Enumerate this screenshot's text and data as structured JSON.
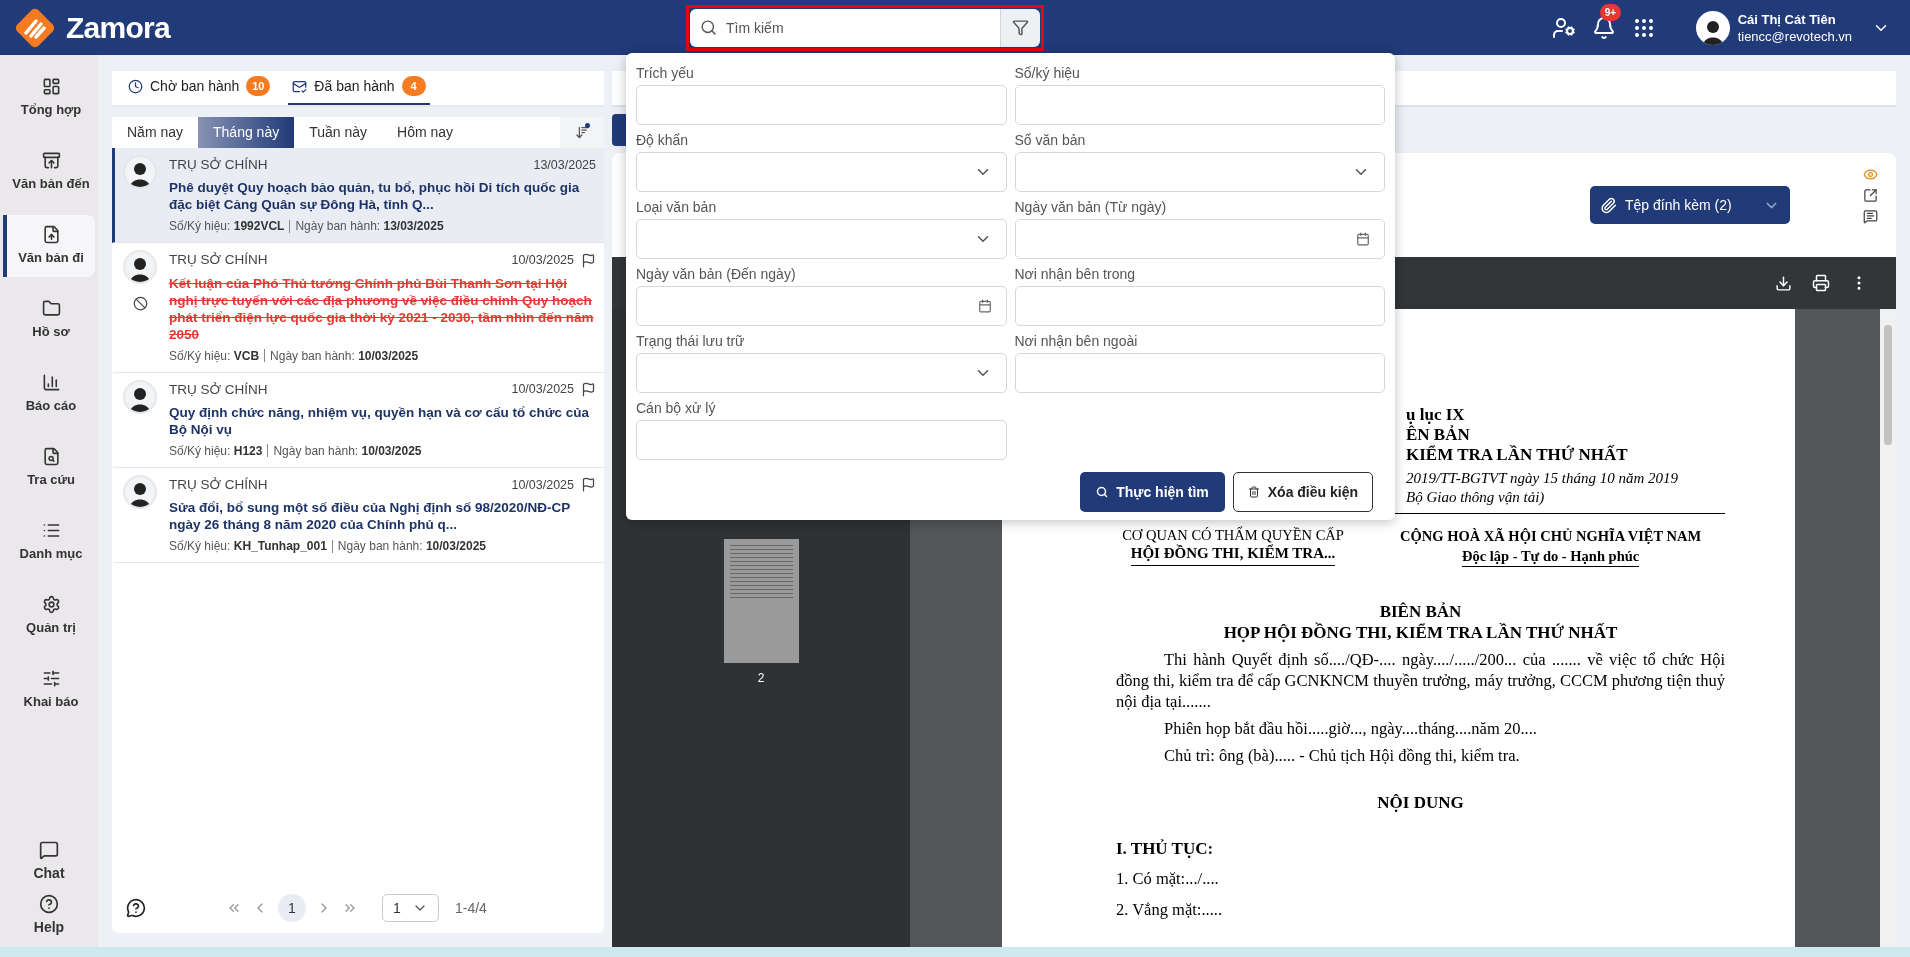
{
  "header": {
    "logo": "Zamora",
    "search": {
      "placeholder": "Tìm kiếm"
    },
    "notification_badge": "9+",
    "user": {
      "name": "Cái Thị Cát Tiên",
      "email": "tiencc@revotech.vn"
    }
  },
  "sidebar": {
    "items": [
      {
        "label": "Tổng hợp",
        "selected": false
      },
      {
        "label": "Văn bản đến",
        "selected": false
      },
      {
        "label": "Văn bản đi",
        "selected": true
      },
      {
        "label": "Hồ sơ",
        "selected": false
      },
      {
        "label": "Báo cáo",
        "selected": false
      },
      {
        "label": "Tra cứu",
        "selected": false
      },
      {
        "label": "Danh mục",
        "selected": false
      },
      {
        "label": "Quản trị",
        "selected": false
      },
      {
        "label": "Khai báo",
        "selected": false
      }
    ],
    "bottom_items": [
      {
        "label": "Chat"
      },
      {
        "label": "Help"
      }
    ]
  },
  "list_panel": {
    "tabs": [
      {
        "label": "Chờ ban hành",
        "count": "10",
        "selected": false
      },
      {
        "label": "Đã ban hành",
        "count": "4",
        "selected": true
      }
    ],
    "periods": [
      {
        "label": "Năm nay",
        "selected": false
      },
      {
        "label": "Tháng này",
        "selected": true
      },
      {
        "label": "Tuần này",
        "selected": false
      },
      {
        "label": "Hôm nay",
        "selected": false
      }
    ],
    "items": [
      {
        "org": "TRỤ SỞ CHÍNH",
        "date": "13/03/2025",
        "title": "Phê duyệt Quy hoạch bảo quản, tu bổ, phục hồi Di tích quốc gia đặc biệt Cảng Quân sự Đông Hà, tỉnh Q...",
        "number_label": "Số/Ký hiệu:",
        "number": "1992VCL",
        "issued_label": "Ngày ban hành:",
        "issued": "13/03/2025",
        "selected": true,
        "revoked": false,
        "flag": false
      },
      {
        "org": "TRỤ SỞ CHÍNH",
        "date": "10/03/2025",
        "title": "Kết luận của Phó Thủ tướng Chính phủ Bùi Thanh Sơn tại Hội nghị trực tuyến với các địa phương về việc điều chỉnh Quy hoạch phát triển điện lực quốc gia thời kỳ 2021 - 2030, tầm nhìn đến năm 2050",
        "number_label": "Số/Ký hiệu:",
        "number": "VCB",
        "issued_label": "Ngày ban hành:",
        "issued": "10/03/2025",
        "selected": false,
        "revoked": true,
        "flag": true
      },
      {
        "org": "TRỤ SỞ CHÍNH",
        "date": "10/03/2025",
        "title": "Quy định chức năng, nhiệm vụ, quyền hạn và cơ cấu tổ chức của Bộ Nội vụ",
        "number_label": "Số/Ký hiệu:",
        "number": "H123",
        "issued_label": "Ngày ban hành:",
        "issued": "10/03/2025",
        "selected": false,
        "revoked": false,
        "flag": true
      },
      {
        "org": "TRỤ SỞ CHÍNH",
        "date": "10/03/2025",
        "title": "Sửa đổi, bổ sung một số điều của Nghị định số 98/2020/NĐ-CP ngày 26 tháng 8 năm 2020 của Chính phủ q...",
        "number_label": "Số/Ký hiệu:",
        "number": "KH_Tunhap_001",
        "issued_label": "Ngày ban hành:",
        "issued": "10/03/2025",
        "selected": false,
        "revoked": false,
        "flag": true
      }
    ],
    "pagination": {
      "current_page": "1",
      "page_select": "1",
      "range": "1-4/4"
    }
  },
  "search_popup": {
    "fields": [
      {
        "label": "Trích yếu",
        "kind": "text"
      },
      {
        "label": "Số/ký hiệu",
        "kind": "text"
      },
      {
        "label": "Độ khẩn",
        "kind": "select"
      },
      {
        "label": "Sổ văn bản",
        "kind": "select"
      },
      {
        "label": "Loại văn bản",
        "kind": "select"
      },
      {
        "label": "Ngày văn bản (Từ ngày)",
        "kind": "date"
      },
      {
        "label": "Ngày văn bản (Đến ngày)",
        "kind": "date"
      },
      {
        "label": "Nơi nhận bên trong",
        "kind": "text"
      },
      {
        "label": "Trạng thái lưu trữ",
        "kind": "select"
      },
      {
        "label": "Nơi nhận bên ngoài",
        "kind": "text"
      },
      {
        "label": "Cán bộ xử lý",
        "kind": "text"
      }
    ],
    "search_button": "Thực hiện tìm",
    "clear_button": "Xóa điều kiện"
  },
  "detail": {
    "attachments_button": "Tệp đính kèm (2)"
  },
  "viewer": {
    "thumbnail_label": "2",
    "partial_heading": [
      "ụ lục IX",
      "ÊN BẢN",
      "KIỂM TRA LẦN THỨ NHẤT"
    ],
    "partial_italic": [
      "2019/TT-BGTVT ngày 15 tháng 10 năm 2019",
      "Bộ Giao thông vận tải)"
    ],
    "left_head": [
      "CƠ QUAN CÓ THẨM QUYỀN CẤP",
      "HỘI ĐỒNG THI, KIỂM TRA..."
    ],
    "right_head": [
      "CỘNG HOÀ XÃ HỘI CHỦ NGHĨA VIỆT NAM",
      "Độc lập - Tự do - Hạnh phúc"
    ],
    "title": [
      "BIÊN BẢN",
      "HỌP HỘI ĐỒNG THI, KIỂM TRA LẦN THỨ NHẤT"
    ],
    "paragraphs": [
      "Thi hành Quyết định số..../QĐ-.... ngày..../...../200... của ....... về việc tổ chức Hội đồng thi, kiểm tra để cấp GCNKNCM thuyền trưởng, máy trưởng, CCCM phương tiện thuỷ nội địa tại.......",
      "Phiên họp bắt đầu hồi.....giờ..., ngày....tháng....năm 20....",
      "Chủ trì: ông (bà)..... - Chủ tịch Hội đồng thi, kiểm tra."
    ],
    "section": "NỘI DUNG",
    "subsection": "I. THỦ TỤC:",
    "lines": [
      "1. Có mặt:.../....",
      "2. Vắng mặt:....."
    ]
  }
}
